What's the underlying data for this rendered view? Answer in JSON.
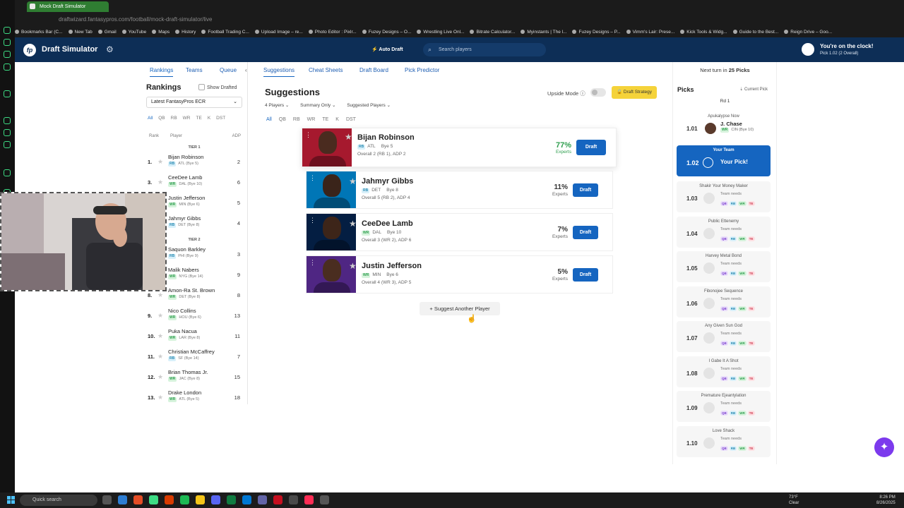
{
  "browser": {
    "tab_title": "Mock Draft Simulator",
    "url": "draftwizard.fantasypros.com/football/mock-draft-simulator/live",
    "bookmarks": [
      "Bookmarks Bar (C...",
      "New Tab",
      "Gmail",
      "YouTube",
      "Maps",
      "History",
      "Football Trading C...",
      "Upload Image – re...",
      "Photo Editor : Pixlr...",
      "Fuzey Designs – O...",
      "Wrestling Live Onl...",
      "Bitrate Calculator...",
      "Myinstants | The l...",
      "Fuzey Designs – P...",
      "Vimm's Lair: Prese...",
      "Kick Tools & Widg...",
      "Guide to the Best...",
      "Reign Drive – Goo..."
    ]
  },
  "header": {
    "logo": "fp",
    "title": "Draft Simulator",
    "auto_draft": "Auto Draft",
    "search_placeholder": "Search players",
    "clock_line1": "You're on the clock!",
    "clock_line2": "Pick 1.02 (2 Overall)"
  },
  "left": {
    "tabs": [
      "Rankings",
      "Teams",
      "Queue"
    ],
    "collapse": "‹",
    "title": "Rankings",
    "show_drafted": "Show Drafted",
    "source": "Latest FantasyPros ECR",
    "positions": [
      "All",
      "QB",
      "RB",
      "WR",
      "TE",
      "K",
      "DST"
    ],
    "col_rank": "Rank",
    "col_player": "Player",
    "col_adp": "ADP",
    "tier1": "TIER 1",
    "tier2": "TIER 2",
    "players": [
      {
        "rank": "1.",
        "name": "Bijan Robinson",
        "pos": "RB",
        "info": "ATL (Bye 5)",
        "adp": "2"
      },
      {
        "rank": "3.",
        "name": "CeeDee Lamb",
        "pos": "WR",
        "info": "DAL (Bye 10)",
        "adp": "6"
      },
      {
        "rank": "4.",
        "name": "Justin Jefferson",
        "pos": "WR",
        "info": "MIN (Bye 6)",
        "adp": "5"
      },
      {
        "rank": "5.",
        "name": "Jahmyr Gibbs",
        "pos": "RB",
        "info": "DET (Bye 8)",
        "adp": "4"
      },
      {
        "rank": "6.",
        "name": "Saquon Barkley",
        "pos": "RB",
        "info": "PHI (Bye 9)",
        "adp": "3"
      },
      {
        "rank": "7.",
        "name": "Malik Nabers",
        "pos": "WR",
        "info": "NYG (Bye 14)",
        "adp": "9"
      },
      {
        "rank": "8.",
        "name": "Amon-Ra St. Brown",
        "pos": "WR",
        "info": "DET (Bye 8)",
        "adp": "8"
      },
      {
        "rank": "9.",
        "name": "Nico Collins",
        "pos": "WR",
        "info": "HOU (Bye 6)",
        "adp": "13"
      },
      {
        "rank": "10.",
        "name": "Puka Nacua",
        "pos": "WR",
        "info": "LAR (Bye 8)",
        "adp": "11"
      },
      {
        "rank": "11.",
        "name": "Christian McCaffrey",
        "pos": "RB",
        "info": "SF (Bye 14)",
        "adp": "7"
      },
      {
        "rank": "12.",
        "name": "Brian Thomas Jr.",
        "pos": "WR",
        "info": "JAC (Bye 8)",
        "adp": "15"
      },
      {
        "rank": "13.",
        "name": "Drake London",
        "pos": "WR",
        "info": "ATL (Bye 5)",
        "adp": "18"
      }
    ]
  },
  "center": {
    "tabs": [
      "Suggestions",
      "Cheat Sheets",
      "Draft Board",
      "Pick Predictor"
    ],
    "title": "Suggestions",
    "filter1": "4 Players ⌄",
    "filter2": "Summary Only ⌄",
    "filter3": "Suggested Players ⌄",
    "upside": "Upside Mode ⓘ",
    "strategy": "🔒 Draft Strategy",
    "positions": [
      "All",
      "QB",
      "RB",
      "WR",
      "TE",
      "K",
      "DST"
    ],
    "suggestions": [
      {
        "name": "Bijan Robinson",
        "pos": "RB",
        "team": "ATL",
        "bye": "Bye 5",
        "overall": "Overall 2 (RB 1), ADP 2",
        "pct": "77%",
        "experts": "Experts",
        "draft": "Draft",
        "jersey": "#a6192e",
        "skin": "#4a2b1f"
      },
      {
        "name": "Jahmyr Gibbs",
        "pos": "RB",
        "team": "DET",
        "bye": "Bye 8",
        "overall": "Overall 5 (RB 2), ADP 4",
        "pct": "11%",
        "experts": "Experts",
        "draft": "Draft",
        "jersey": "#0076b6",
        "skin": "#3a241a"
      },
      {
        "name": "CeeDee Lamb",
        "pos": "WR",
        "team": "DAL",
        "bye": "Bye 10",
        "overall": "Overall 3 (WR 2), ADP 6",
        "pct": "7%",
        "experts": "Experts",
        "draft": "Draft",
        "jersey": "#041e42",
        "skin": "#3d2519"
      },
      {
        "name": "Justin Jefferson",
        "pos": "WR",
        "team": "MIN",
        "bye": "Bye 6",
        "overall": "Overall 4 (WR 3), ADP 5",
        "pct": "5%",
        "experts": "Experts",
        "draft": "Draft",
        "jersey": "#4f2683",
        "skin": "#4a2d20"
      }
    ],
    "suggest_more": "+ Suggest Another Player"
  },
  "right": {
    "next_turn_prefix": "Next turn in ",
    "next_turn_value": "25 Picks",
    "title": "Picks",
    "current_pick": "⇣ Current Pick",
    "round": "Rd 1",
    "picks": [
      {
        "team": "Apukalypse Now",
        "num": "1.01",
        "player": "J. Chase",
        "pos": "WR",
        "info": "CIN (Bye 10)",
        "type": "made"
      },
      {
        "team": "Your Team",
        "num": "1.02",
        "label": "Your Pick!",
        "type": "yours"
      },
      {
        "team": "Shakir Your Money Maker",
        "num": "1.03",
        "needs_label": "Team needs",
        "needs": [
          "QB",
          "RB",
          "WR",
          "TE"
        ],
        "type": "pending"
      },
      {
        "team": "Public Ettenemy",
        "num": "1.04",
        "needs_label": "Team needs",
        "needs": [
          "QB",
          "RB",
          "WR",
          "TE"
        ],
        "type": "pending"
      },
      {
        "team": "Harvey Metal Bond",
        "num": "1.05",
        "needs_label": "Team needs",
        "needs": [
          "QB",
          "RB",
          "WR",
          "TE"
        ],
        "type": "pending"
      },
      {
        "team": "Fibonojee Sequence",
        "num": "1.06",
        "needs_label": "Team needs",
        "needs": [
          "QB",
          "RB",
          "WR",
          "TE"
        ],
        "type": "pending"
      },
      {
        "team": "Any Given Sun God",
        "num": "1.07",
        "needs_label": "Team needs",
        "needs": [
          "QB",
          "RB",
          "WR",
          "TE"
        ],
        "type": "pending"
      },
      {
        "team": "I Gabe It A Shot",
        "num": "1.08",
        "needs_label": "Team needs",
        "needs": [
          "QB",
          "RB",
          "WR",
          "TE"
        ],
        "type": "pending"
      },
      {
        "team": "Premature Ejeantylation",
        "num": "1.09",
        "needs_label": "Team needs",
        "needs": [
          "QB",
          "RB",
          "WR",
          "TE"
        ],
        "type": "pending"
      },
      {
        "team": "Love Shack",
        "num": "1.10",
        "needs_label": "Team needs",
        "needs": [
          "QB",
          "RB",
          "WR",
          "TE"
        ],
        "type": "pending"
      }
    ]
  },
  "taskbar": {
    "search": "Quick search",
    "weather_temp": "73°F",
    "weather_cond": "Clear",
    "time": "8:26 PM",
    "date": "8/26/2025"
  },
  "colors": {
    "primary": "#1565c0",
    "header": "#0d2e56",
    "strategy": "#f5d33a",
    "experts_top": "#2e9e4e"
  }
}
